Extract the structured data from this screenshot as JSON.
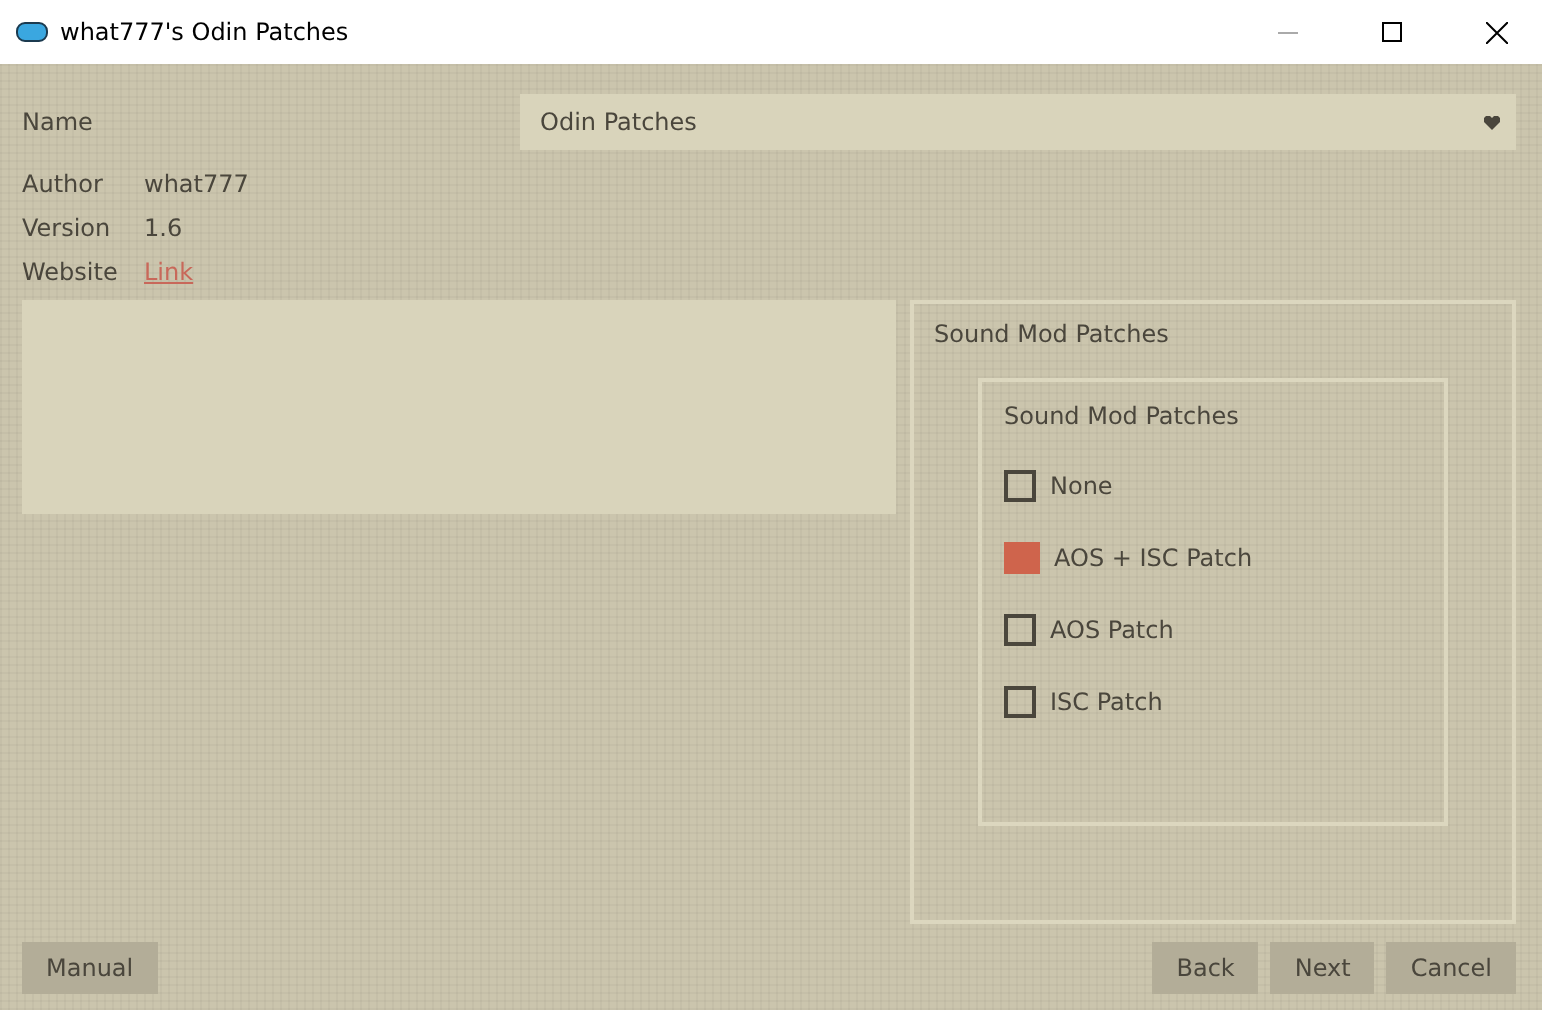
{
  "window": {
    "title": "what777's Odin Patches"
  },
  "name": {
    "label": "Name",
    "value": "Odin Patches"
  },
  "info": [
    {
      "label": "Author",
      "value": "what777",
      "kind": "text"
    },
    {
      "label": "Version",
      "value": "1.6",
      "kind": "text"
    },
    {
      "label": "Website",
      "value": "Link",
      "kind": "link"
    }
  ],
  "group": {
    "title": "Sound Mod Patches",
    "inner_title": "Sound Mod Patches",
    "options": [
      {
        "label": "None",
        "selected": false
      },
      {
        "label": "AOS + ISC Patch",
        "selected": true
      },
      {
        "label": "AOS Patch",
        "selected": false
      },
      {
        "label": "ISC Patch",
        "selected": false
      }
    ]
  },
  "buttons_left": [
    "Manual"
  ],
  "buttons_right": [
    "Back",
    "Next",
    "Cancel"
  ]
}
